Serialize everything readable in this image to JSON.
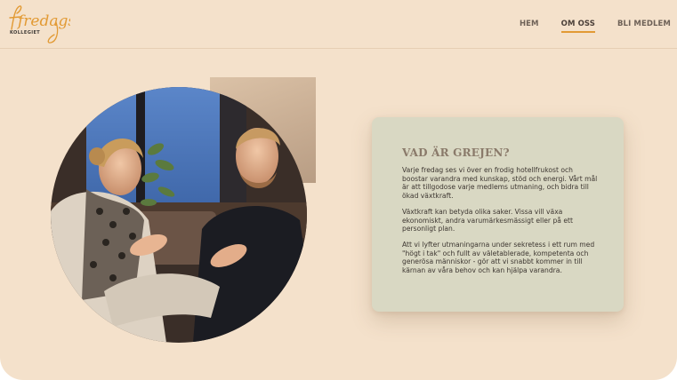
{
  "header": {
    "logo_text": "fredags",
    "logo_sub": "KOLLEGIET",
    "nav": [
      {
        "label": "HEM",
        "active": false
      },
      {
        "label": "OM OSS",
        "active": true
      },
      {
        "label": "BLI MEDLEM",
        "active": false
      }
    ]
  },
  "card": {
    "title": "VAD ÄR GREJEN?",
    "paragraphs": [
      "Varje fredag ses vi över en frodig hotellfrukost och boostar varandra med kunskap, stöd och energi. Vårt mål är att tillgodose varje medlems utmaning, och bidra till ökad växtkraft.",
      "Växtkraft kan betyda olika saker. Vissa vill växa ekonomiskt, andra varumärkesmässigt eller på ett personligt plan.",
      "Att vi lyfter utmaningarna under sekretess i ett rum med \"högt i tak\" och fullt av väletablerade, kompetenta och generösa människor - gör att vi snabbt kommer in till kärnan av våra behov och kan hjälpa varandra."
    ]
  },
  "colors": {
    "background": "#f4e1cb",
    "accent": "#e29a34",
    "card": "#d9d8c3",
    "title": "#8a7a6a"
  }
}
